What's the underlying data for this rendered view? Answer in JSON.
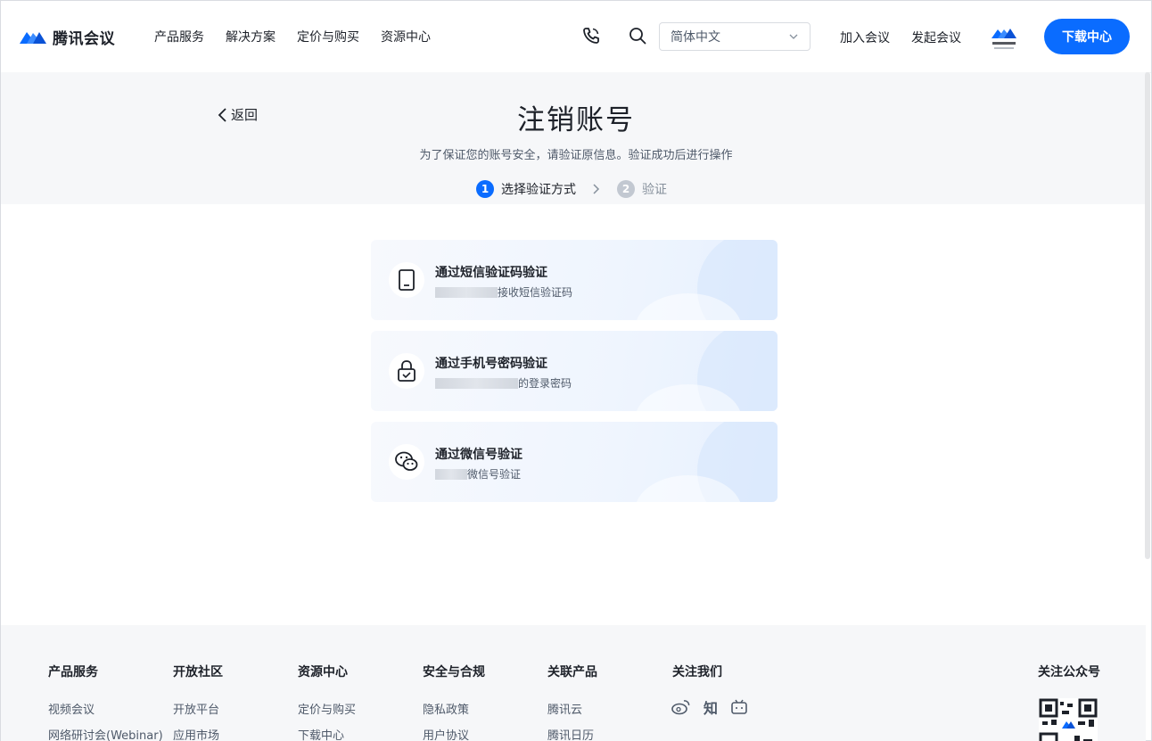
{
  "header": {
    "logo_text": "腾讯会议",
    "nav": [
      "产品服务",
      "解决方案",
      "定价与购买",
      "资源中心"
    ],
    "language_selected": "简体中文",
    "join_meeting": "加入会议",
    "start_meeting": "发起会议",
    "download_center": "下载中心",
    "icons": [
      "phone-icon",
      "search-icon",
      "chevron-down-icon"
    ]
  },
  "page": {
    "back_label": "返回",
    "title": "注销账号",
    "subtitle": "为了保证您的账号安全，请验证原信息。验证成功后进行操作"
  },
  "steps": [
    {
      "num": "1",
      "label": "选择验证方式",
      "active": true
    },
    {
      "num": "2",
      "label": "验证",
      "active": false
    }
  ],
  "options": [
    {
      "title": "通过短信验证码验证",
      "desc": "接收短信验证码",
      "icon": "phone-device-icon"
    },
    {
      "title": "通过手机号密码验证",
      "desc": "的登录密码",
      "icon": "lock-icon"
    },
    {
      "title": "通过微信号验证",
      "desc": "微信号验证",
      "icon": "wechat-icon"
    }
  ],
  "footer": {
    "columns": [
      {
        "heading": "产品服务",
        "items": [
          "视频会议",
          "网络研讨会(Webinar)"
        ]
      },
      {
        "heading": "开放社区",
        "items": [
          "开放平台",
          "应用市场"
        ]
      },
      {
        "heading": "资源中心",
        "items": [
          "定价与购买",
          "下载中心"
        ]
      },
      {
        "heading": "安全与合规",
        "items": [
          "隐私政策",
          "用户协议"
        ]
      },
      {
        "heading": "关联产品",
        "items": [
          "腾讯云",
          "腾讯日历"
        ]
      }
    ],
    "follow_us": "关注我们",
    "zhihu": "知",
    "follow_official": "关注公众号"
  },
  "colors": {
    "accent": "#0a6cff",
    "band": "#f6f7f9"
  }
}
